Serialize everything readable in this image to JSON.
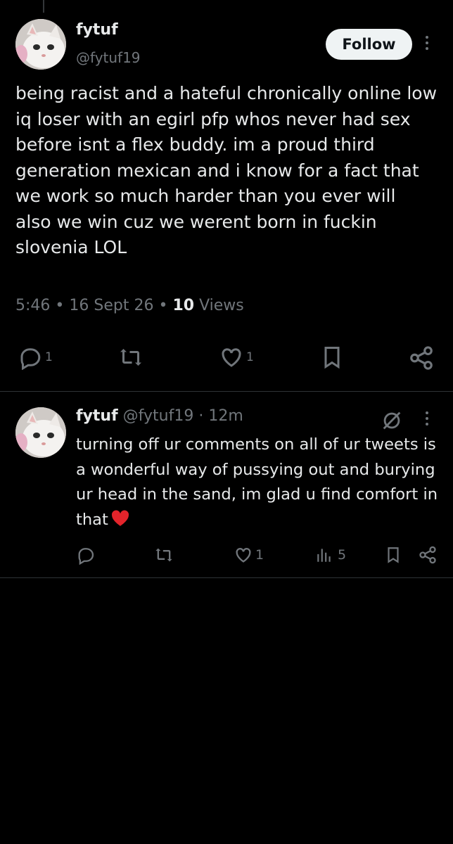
{
  "main_tweet": {
    "author_name": "fytuf",
    "handle": "@fytuf19",
    "follow_label": "Follow",
    "text": "being racist and a hateful chronically online low iq loser with an egirl pfp whos never had sex before isnt a flex buddy. im a proud third generation mexican and i know for a fact that we work so much harder than you ever will\nalso we win cuz we werent born in fuckin slovenia LOL",
    "time": "5:46",
    "separator": "•",
    "date": "16 Sept 26",
    "views_count": "10",
    "views_label": "Views",
    "reply_count": "1",
    "like_count": "1"
  },
  "reply_tweet": {
    "author_name": "fytuf",
    "handle_time": "@fytuf19 · 12m",
    "text": "turning off ur comments on all of ur tweets is a wonderful way of pussying out and burying ur head in the sand, im glad u find comfort in that",
    "emoji": "red-heart",
    "like_count": "1",
    "views_count": "5"
  },
  "colors": {
    "background": "#000000",
    "text_primary": "#e7e9ea",
    "text_secondary": "#71767b",
    "divider": "#2f3336",
    "follow_bg": "#eff3f4",
    "heart_red": "#e3242b"
  }
}
